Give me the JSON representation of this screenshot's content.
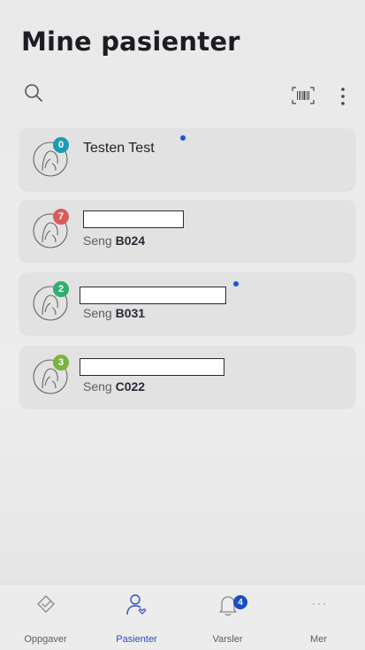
{
  "header": {
    "title": "Mine pasienter",
    "icons": [
      "search-icon",
      "barcode-icon",
      "more-vertical-icon"
    ]
  },
  "patients": [
    {
      "name": "Testen Test",
      "bed_label": "",
      "bed_number": "",
      "badge": "0",
      "badge_color": "#1f9bb0",
      "unread": true,
      "redacted": false
    },
    {
      "name": "",
      "bed_label": "Seng",
      "bed_number": "B024",
      "badge": "7",
      "badge_color": "#d95b5b",
      "unread": false,
      "redacted": true
    },
    {
      "name": "",
      "bed_label": "Seng",
      "bed_number": "B031",
      "badge": "2",
      "badge_color": "#2fae6f",
      "unread": true,
      "redacted": true
    },
    {
      "name": "",
      "bed_label": "Seng",
      "bed_number": "C022",
      "badge": "3",
      "badge_color": "#7ab33e",
      "unread": false,
      "redacted": true
    }
  ],
  "bottom_nav": {
    "items": [
      {
        "label": "Oppgaver",
        "icon": "tasks-check-icon",
        "active": false
      },
      {
        "label": "Pasienter",
        "icon": "patient-person-icon",
        "active": true
      },
      {
        "label": "Varsler",
        "icon": "bell-icon",
        "active": false,
        "badge": "4"
      },
      {
        "label": "Mer",
        "icon": "more-dots-icon",
        "active": false
      }
    ]
  },
  "colors": {
    "accent": "#2c4fc4",
    "unread_dot": "#1a56d6"
  }
}
